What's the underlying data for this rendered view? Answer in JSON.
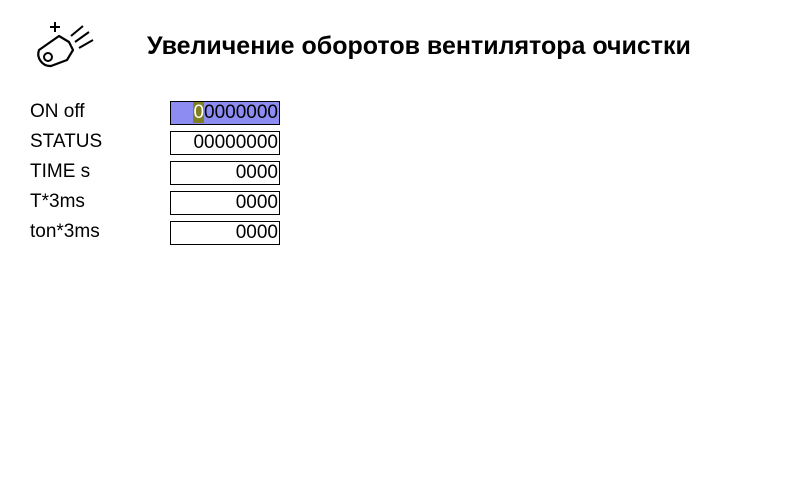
{
  "header": {
    "title": "Увеличение оборотов вентилятора очистки",
    "icon": "fan-speed-increase-icon"
  },
  "params": [
    {
      "label": "ON off",
      "value_caret": "0",
      "value_rest": "0000000",
      "selected": true
    },
    {
      "label": "STATUS",
      "value": "00000000"
    },
    {
      "label": "TIME s",
      "value": "0000"
    },
    {
      "label": "T*3ms",
      "value": "0000"
    },
    {
      "label": "ton*3ms",
      "value": "0000"
    }
  ],
  "colors": {
    "selection": "#8c8cf2",
    "caret": "#7f7f1f"
  }
}
